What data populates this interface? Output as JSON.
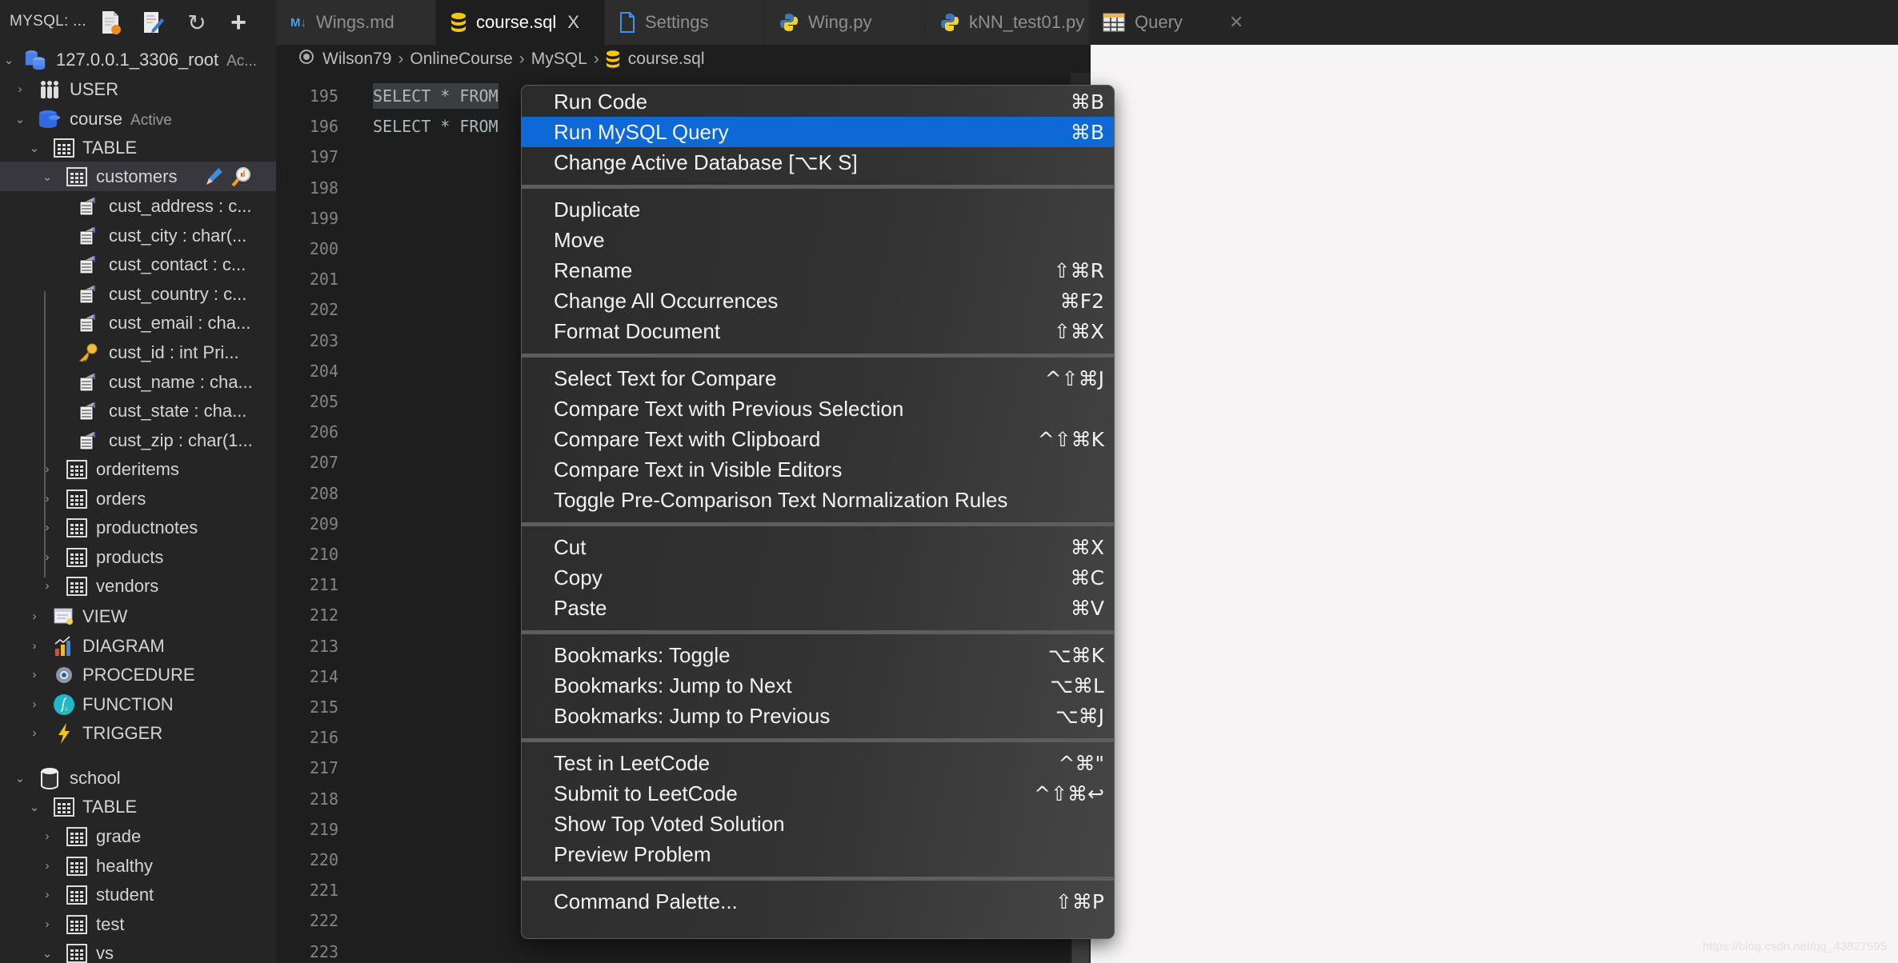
{
  "sidebar_header": {
    "title": "MYSQL: ...",
    "buttons": [
      {
        "name": "new-query-button",
        "icon": "new-query-icon"
      },
      {
        "name": "edit-button",
        "icon": "edit-icon"
      },
      {
        "name": "refresh-button",
        "icon": "refresh-icon",
        "glyph": "↻"
      },
      {
        "name": "add-connection-button",
        "icon": "plus-icon",
        "glyph": "+"
      }
    ]
  },
  "tabs": [
    {
      "label": "Wings.md",
      "icon": "markdown-icon",
      "icon_text": "M↓",
      "active": false
    },
    {
      "label": "course.sql",
      "icon": "database-icon",
      "active": true,
      "close": "X"
    },
    {
      "label": "Settings",
      "icon": "file-icon",
      "active": false
    },
    {
      "label": "Wing.py",
      "icon": "python-icon",
      "active": false
    },
    {
      "label": "kNN_test01.py",
      "icon": "python-icon",
      "active": false
    },
    {
      "label": "Query",
      "icon": "table-icon",
      "active": false,
      "close": "✕"
    }
  ],
  "breadcrumb": {
    "items": [
      "Wilson79",
      "OnlineCourse",
      "MySQL",
      "course.sql"
    ],
    "separator": "›"
  },
  "tree": {
    "connection": {
      "label": "127.0.0.1_3306_root",
      "status": "Ac..."
    },
    "user": "USER",
    "db_course": {
      "label": "course",
      "status": "Active"
    },
    "table_group": "TABLE",
    "customers": "customers",
    "columns": [
      "cust_address : c...",
      "cust_city : char(...",
      "cust_contact : c...",
      "cust_country : c...",
      "cust_email : cha...",
      "cust_id : int  Pri...",
      "cust_name : cha...",
      "cust_state : cha...",
      "cust_zip : char(1..."
    ],
    "course_tables": [
      "orderitems",
      "orders",
      "productnotes",
      "products",
      "vendors"
    ],
    "groups": [
      "VIEW",
      "DIAGRAM",
      "PROCEDURE",
      "FUNCTION",
      "TRIGGER"
    ],
    "db_school": "school",
    "school_table_group": "TABLE",
    "school_tables": [
      "grade",
      "healthy",
      "student",
      "test",
      "vs"
    ]
  },
  "editor": {
    "lines": [
      {
        "n": "195",
        "code": "SELECT * FROM",
        "highlighted": true
      },
      {
        "n": "196",
        "code": "SELECT * FROM",
        "highlighted": false
      },
      {
        "n": "197",
        "code": ""
      },
      {
        "n": "198",
        "code": ""
      },
      {
        "n": "199",
        "code": ""
      },
      {
        "n": "200",
        "code": ""
      },
      {
        "n": "201",
        "code": ""
      },
      {
        "n": "202",
        "code": ""
      },
      {
        "n": "203",
        "code": ""
      },
      {
        "n": "204",
        "code": ""
      },
      {
        "n": "205",
        "code": ""
      },
      {
        "n": "206",
        "code": ""
      },
      {
        "n": "207",
        "code": ""
      },
      {
        "n": "208",
        "code": ""
      },
      {
        "n": "209",
        "code": ""
      },
      {
        "n": "210",
        "code": ""
      },
      {
        "n": "211",
        "code": ""
      },
      {
        "n": "212",
        "code": ""
      },
      {
        "n": "213",
        "code": ""
      },
      {
        "n": "214",
        "code": ""
      },
      {
        "n": "215",
        "code": ""
      },
      {
        "n": "216",
        "code": ""
      },
      {
        "n": "217",
        "code": ""
      },
      {
        "n": "218",
        "code": ""
      },
      {
        "n": "219",
        "code": ""
      },
      {
        "n": "220",
        "code": ""
      },
      {
        "n": "221",
        "code": ""
      },
      {
        "n": "222",
        "code": ""
      },
      {
        "n": "223",
        "code": ""
      }
    ]
  },
  "context_menu": {
    "highlight_color": "#0e68d6",
    "groups": [
      [
        {
          "label": "Run Code",
          "shortcut": "⌘B"
        },
        {
          "label": "Run MySQL Query",
          "shortcut": "⌘B",
          "highlighted": true
        },
        {
          "label": "Change Active Database [⌥K S]",
          "shortcut": ""
        }
      ],
      [
        {
          "label": "Duplicate",
          "shortcut": ""
        },
        {
          "label": "Move",
          "shortcut": ""
        },
        {
          "label": "Rename",
          "shortcut": "⇧⌘R"
        },
        {
          "label": "Change All Occurrences",
          "shortcut": "⌘F2"
        },
        {
          "label": "Format Document",
          "shortcut": "⇧⌘X"
        }
      ],
      [
        {
          "label": "Select Text for Compare",
          "shortcut": "^⇧⌘J"
        },
        {
          "label": "Compare Text with Previous Selection",
          "shortcut": ""
        },
        {
          "label": "Compare Text with Clipboard",
          "shortcut": "^⇧⌘K"
        },
        {
          "label": "Compare Text in Visible Editors",
          "shortcut": ""
        },
        {
          "label": "Toggle Pre-Comparison Text Normalization Rules",
          "shortcut": ""
        }
      ],
      [
        {
          "label": "Cut",
          "shortcut": "⌘X"
        },
        {
          "label": "Copy",
          "shortcut": "⌘C"
        },
        {
          "label": "Paste",
          "shortcut": "⌘V"
        }
      ],
      [
        {
          "label": "Bookmarks: Toggle",
          "shortcut": "⌥⌘K"
        },
        {
          "label": "Bookmarks: Jump to Next",
          "shortcut": "⌥⌘L"
        },
        {
          "label": "Bookmarks: Jump to Previous",
          "shortcut": "⌥⌘J"
        }
      ],
      [
        {
          "label": "Test in LeetCode",
          "shortcut": "^⌘\""
        },
        {
          "label": "Submit to LeetCode",
          "shortcut": "^⇧⌘↩"
        },
        {
          "label": "Show Top Voted Solution",
          "shortcut": ""
        },
        {
          "label": "Preview Problem",
          "shortcut": ""
        }
      ],
      [
        {
          "label": "Command Palette...",
          "shortcut": "⇧⌘P"
        }
      ]
    ]
  },
  "query_panel": {
    "watermark": "https://blog.csdn.net/qq_43827595"
  }
}
